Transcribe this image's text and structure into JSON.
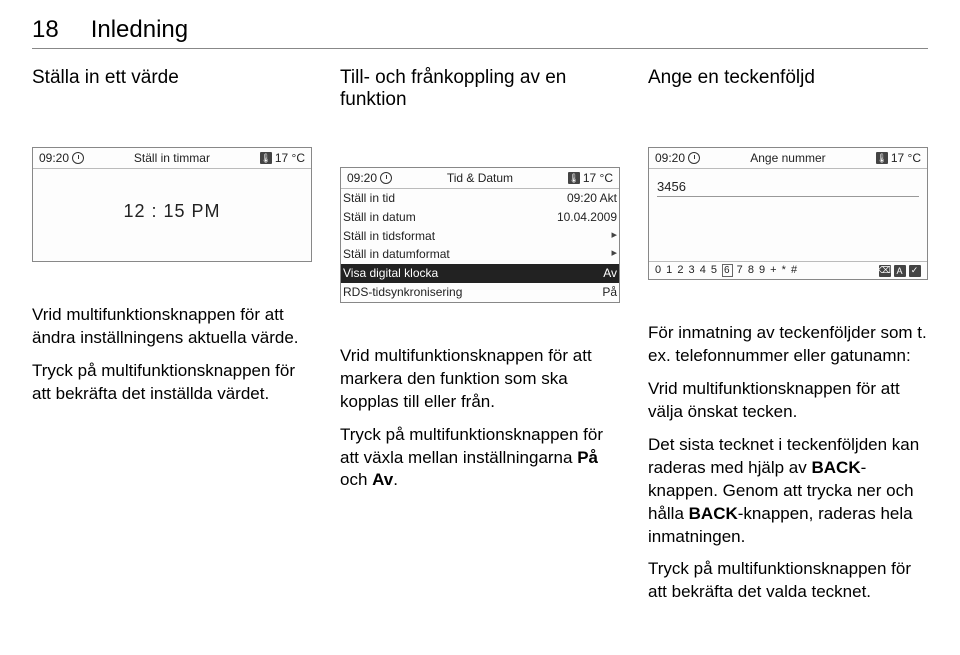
{
  "page": {
    "number": "18",
    "title": "Inledning"
  },
  "cols": [
    {
      "subhead": "Ställa in ett värde",
      "display": {
        "time": "09:20",
        "title": "Ställ in timmar",
        "temp": "17 °C",
        "big_time": "12 : 15 PM"
      },
      "paras": [
        "Vrid multifunktionsknappen för att ändra inställningens aktuella värde.",
        "Tryck på multifunktionsknappen för att bekräfta det inställda värdet."
      ]
    },
    {
      "subhead": "Till- och frånkoppling av en funktion",
      "display": {
        "time": "09:20",
        "title": "Tid & Datum",
        "temp": "17 °C",
        "rows": [
          {
            "label": "Ställ in tid",
            "value": "09:20 Akt"
          },
          {
            "label": "Ställ in datum",
            "value": "10.04.2009"
          },
          {
            "label": "Ställ in tidsformat",
            "value": "▸"
          },
          {
            "label": "Ställ in datumformat",
            "value": "▸"
          },
          {
            "label": "Visa digital klocka",
            "value": "Av",
            "selected": true
          },
          {
            "label": "RDS-tidsynkronisering",
            "value": "På"
          }
        ]
      },
      "paras": [
        "Vrid multifunktionsknappen för att markera den funktion som ska kopplas till eller från.",
        "Tryck på multifunktionsknappen för att växla mellan inställningarna <b>På</b> och <b>Av</b>."
      ]
    },
    {
      "subhead": "Ange en teckenföljd",
      "display": {
        "time": "09:20",
        "title": "Ange nummer",
        "temp": "17 °C",
        "input": "3456",
        "footer_chars": "0 1 2 3 4 5 6 7 8 9 + * #"
      },
      "paras": [
        "För inmatning av teckenföljder som t. ex. telefonnummer eller gatunamn:",
        "Vrid multifunktionsknappen för att välja önskat tecken.",
        "Det sista tecknet i teckenföljden kan raderas med hjälp av <b>BACK</b>-knappen. Genom att trycka ner och hålla <b>BACK</b>-knappen, raderas hela inmatningen.",
        "Tryck på multifunktionsknappen för att bekräfta det valda tecknet."
      ]
    }
  ]
}
